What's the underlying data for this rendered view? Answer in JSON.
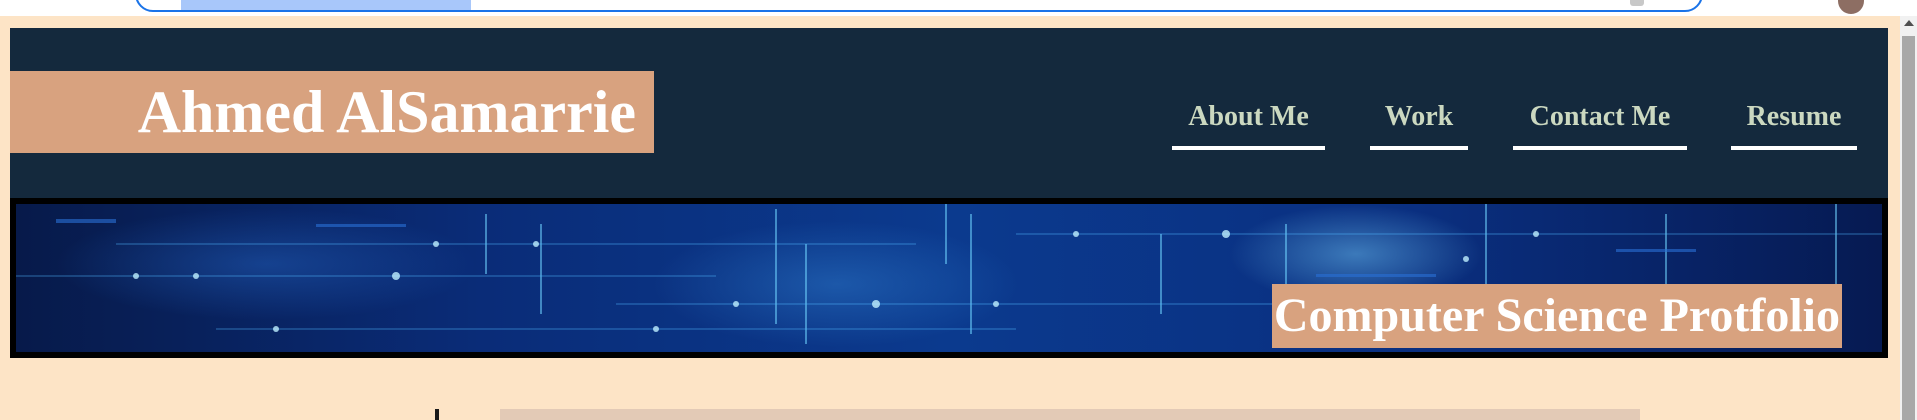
{
  "site": {
    "name": "Ahmed AlSamarrie",
    "tagline": "Computer Science Protfolio"
  },
  "nav": {
    "items": [
      {
        "label": "About Me"
      },
      {
        "label": "Work"
      },
      {
        "label": "Contact Me"
      },
      {
        "label": "Resume"
      }
    ]
  },
  "colors": {
    "page_background": "#fde4c6",
    "header_background": "#14293d",
    "name_box": "#d8a27f",
    "nav_text": "#cbd8c0",
    "nav_underline": "#ffffff",
    "tagline_box": "#d8a27f",
    "browser_focus": "#1a73e8"
  },
  "icons": {
    "profile": "avatar-icon",
    "scroll_up": "scroll-up-arrow-icon"
  }
}
